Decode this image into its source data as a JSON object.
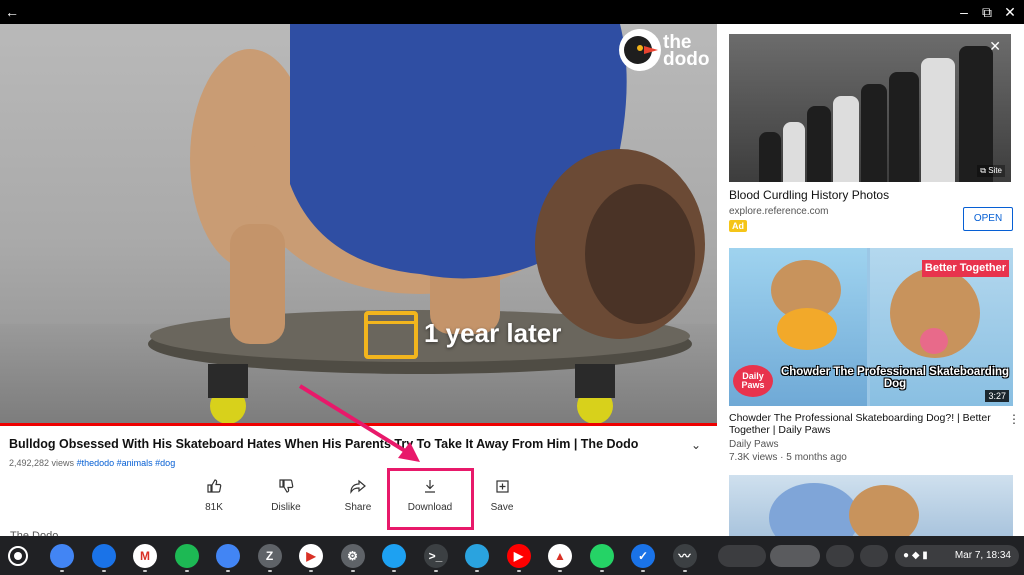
{
  "titlebar": {
    "back_icon": "←",
    "minimize_icon": "–",
    "restore_icon": "⧉",
    "close_icon": "✕"
  },
  "video": {
    "logo_text": "the dodo",
    "overlay_text": "1 year later",
    "title": "Bulldog Obsessed With His Skateboard Hates When His Parents Try To Take It Away From Him | The Dodo",
    "views": "2,492,282 views",
    "tags": [
      "#thedodo",
      "#animals",
      "#dog"
    ],
    "expand_icon": "⌄",
    "actions": [
      {
        "label": "81K",
        "icon": "thumbs-up-icon",
        "glyph": "👍"
      },
      {
        "label": "Dislike",
        "icon": "thumbs-down-icon",
        "glyph": "👎"
      },
      {
        "label": "Share",
        "icon": "share-icon",
        "glyph": "↗"
      },
      {
        "label": "Download",
        "icon": "download-icon",
        "glyph": "⤓"
      },
      {
        "label": "Save",
        "icon": "save-playlist-icon",
        "glyph": "⊞"
      }
    ],
    "channel": "The Dodo",
    "highlight_color": "#e8196a",
    "progress_color": "#ee0000"
  },
  "sidebar": {
    "ad": {
      "title": "Blood Curdling History Photos",
      "url": "explore.reference.com",
      "badge": "Ad",
      "open_label": "OPEN",
      "site_label": "⧉ Site",
      "close_icon": "✕"
    },
    "video2": {
      "thumb_badge": "Better Together",
      "brand": "Daily Paws",
      "caption": "Chowder The Professional Skateboarding Dog",
      "duration": "3:27",
      "title": "Chowder The Professional Skateboarding Dog?! | Better Together | Daily Paws",
      "channel": "Daily Paws",
      "stats": "7.3K views · 5 months ago",
      "more_icon": "⋮"
    }
  },
  "shelf": {
    "apps": [
      {
        "name": "chrome-icon",
        "glyph": "",
        "color": "#4285f4"
      },
      {
        "name": "files-icon",
        "glyph": "",
        "color": "#1a73e8"
      },
      {
        "name": "gmail-icon",
        "glyph": "M",
        "color": "#ffffff"
      },
      {
        "name": "spotify-icon",
        "glyph": "",
        "color": "#1db954"
      },
      {
        "name": "docs-icon",
        "glyph": "",
        "color": "#4285f4"
      },
      {
        "name": "z-app-icon",
        "glyph": "Z",
        "color": "#5f6368"
      },
      {
        "name": "play-store-icon",
        "glyph": "▶",
        "color": "#ffffff"
      },
      {
        "name": "settings-icon",
        "glyph": "⚙",
        "color": "#5f6368"
      },
      {
        "name": "twitter-icon",
        "glyph": "",
        "color": "#1da1f2"
      },
      {
        "name": "terminal-icon",
        "glyph": ">_",
        "color": "#3c4043"
      },
      {
        "name": "telegram-icon",
        "glyph": "",
        "color": "#2aa3df"
      },
      {
        "name": "youtube-icon",
        "glyph": "▶",
        "color": "#ff0000"
      },
      {
        "name": "drive-icon",
        "glyph": "▲",
        "color": "#ffffff"
      },
      {
        "name": "whatsapp-icon",
        "glyph": "",
        "color": "#25d366"
      },
      {
        "name": "tasks-icon",
        "glyph": "✓",
        "color": "#1a73e8"
      },
      {
        "name": "activity-icon",
        "glyph": "〰",
        "color": "#3c4043"
      }
    ],
    "clock": "Mar 7, 18:34"
  }
}
